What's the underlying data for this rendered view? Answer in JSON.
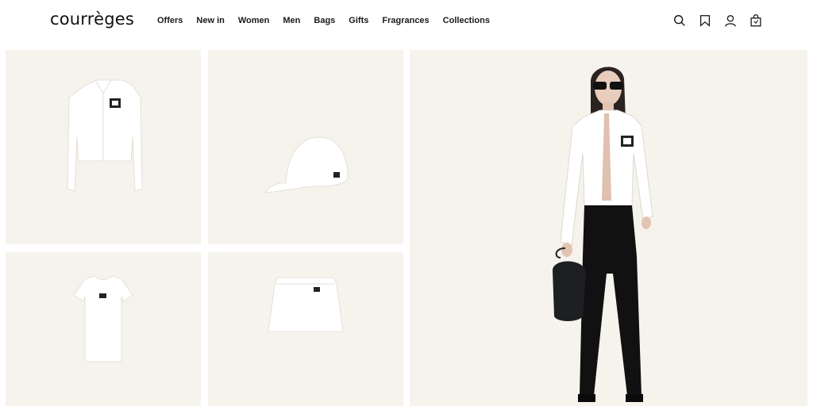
{
  "header": {
    "logo": "courrèges",
    "nav": [
      "Offers",
      "New in",
      "Women",
      "Men",
      "Bags",
      "Gifts",
      "Fragrances",
      "Collections"
    ],
    "icons": [
      "search-icon",
      "bookmark-icon",
      "account-icon",
      "shopping-bag-icon"
    ]
  },
  "products": [
    {
      "name": "cropped-jacket",
      "icon": "jacket-product-image"
    },
    {
      "name": "cap",
      "icon": "cap-product-image"
    },
    {
      "name": "tshirt",
      "icon": "tshirt-product-image"
    },
    {
      "name": "mini-skirt",
      "icon": "skirt-product-image"
    }
  ],
  "colors": {
    "tile_background": "#f5f3ec",
    "accent": "#111111"
  }
}
